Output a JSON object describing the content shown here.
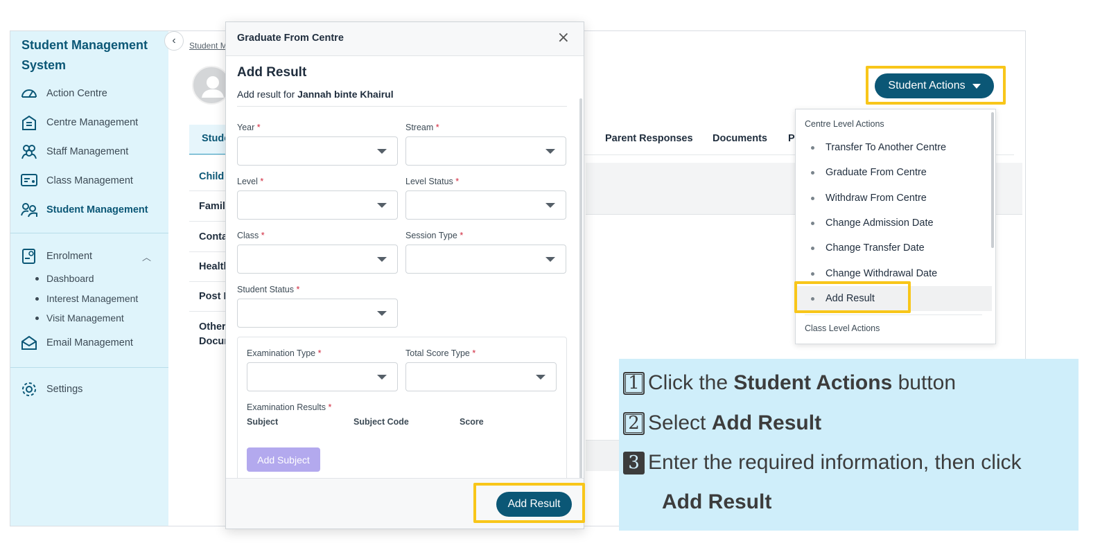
{
  "sidebar": {
    "title": "Student Management System",
    "items": [
      {
        "label": "Action Centre",
        "icon": "gauge-icon"
      },
      {
        "label": "Centre Management",
        "icon": "building-icon"
      },
      {
        "label": "Staff Management",
        "icon": "people-group-icon"
      },
      {
        "label": "Class Management",
        "icon": "classroom-board-icon"
      },
      {
        "label": "Student Management",
        "icon": "students-icon"
      }
    ],
    "enrolment": {
      "label": "Enrolment",
      "icon": "enrolment-form-icon",
      "sub_items": [
        "Dashboard",
        "Interest Management",
        "Visit Management"
      ]
    },
    "email": {
      "label": "Email Management",
      "icon": "envelope-icon"
    },
    "settings": {
      "label": "Settings",
      "icon": "gear-icon"
    },
    "active_color": "#0b5776",
    "background": "#dff4fb"
  },
  "main": {
    "breadcrumb": "Student M",
    "tabs": [
      {
        "label": "Stude"
      },
      {
        "label": "Parent Responses"
      },
      {
        "label": "Documents"
      },
      {
        "label": "P"
      }
    ],
    "side_list": [
      "Child",
      "Family",
      "Conta",
      "Healtl",
      "Post F",
      "Other",
      "Docur"
    ]
  },
  "student_actions": {
    "label": "Student Actions",
    "menu": {
      "centre_heading": "Centre Level Actions",
      "items": [
        "Transfer To Another Centre",
        "Graduate From Centre",
        "Withdraw From Centre",
        "Change Admission Date",
        "Change Transfer Date",
        "Change Withdrawal Date",
        "Add Result"
      ],
      "class_heading": "Class Level Actions"
    }
  },
  "modal": {
    "title": "Graduate From Centre",
    "heading": "Add Result",
    "subtitle_prefix": "Add result for",
    "student_name": "Jannah binte Khairul",
    "fields": {
      "year": "Year",
      "stream": "Stream",
      "level": "Level",
      "level_status": "Level Status",
      "class": "Class",
      "session_type": "Session Type",
      "student_status": "Student Status",
      "examination_type": "Examination Type",
      "total_score_type": "Total Score Type",
      "examination_results": "Examination Results"
    },
    "required_mark": "*",
    "results_columns": [
      "Subject",
      "Subject Code",
      "Score"
    ],
    "add_subject_label": "Add Subject",
    "submit_label": "Add Result",
    "close_glyph": "×"
  },
  "instructions": {
    "steps": [
      {
        "num": "1",
        "prefix": "Click the ",
        "bold": "Student Actions",
        "suffix": " button"
      },
      {
        "num": "2",
        "prefix": "Select ",
        "bold": "Add Result",
        "suffix": ""
      },
      {
        "num": "3",
        "prefix": "Enter the required information, then click",
        "bold": "Add Result",
        "suffix": ""
      }
    ],
    "background": "#cfeefa"
  },
  "colors": {
    "primary": "#0b5776",
    "highlight": "#f8c61a",
    "required": "#d0263b",
    "add_subject": "#b3a9ee"
  }
}
